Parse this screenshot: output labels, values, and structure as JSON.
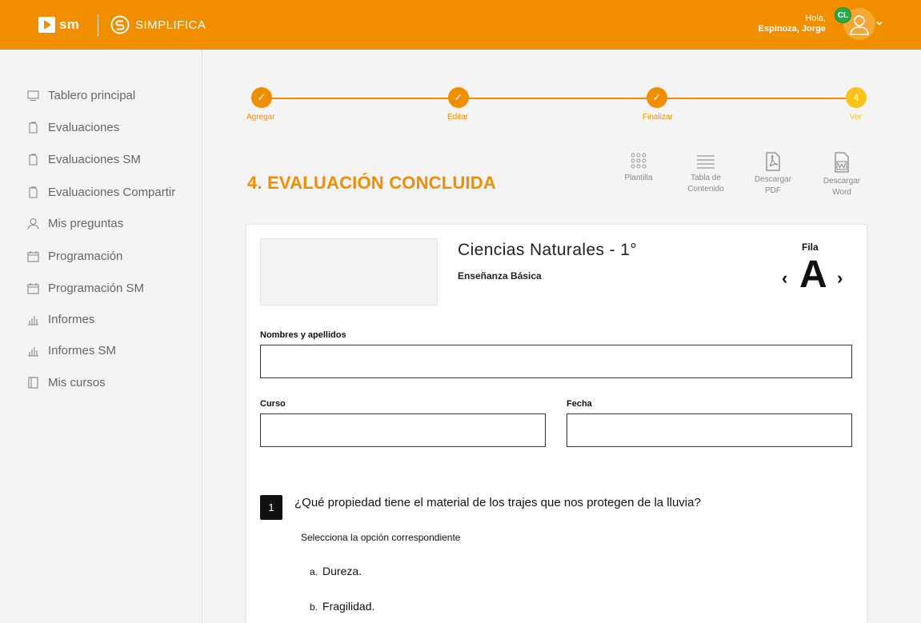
{
  "header": {
    "brand_sm": "sm",
    "brand_simplifica": "SIMPLIFICA",
    "greeting": "Hola,",
    "user_name": "Espinoza, Jorge",
    "badge": "CL",
    "accent_color": "#f18e00"
  },
  "sidebar": {
    "items": [
      {
        "label": "Tablero principal",
        "icon": "monitor-icon"
      },
      {
        "label": "Evaluaciones",
        "icon": "document-icon"
      },
      {
        "label": "Evaluaciones SM",
        "icon": "document-icon"
      },
      {
        "label": "Evaluaciones Compartir",
        "icon": "document-icon"
      },
      {
        "label": "Mis preguntas",
        "icon": "user-icon"
      },
      {
        "label": "Programación",
        "icon": "calendar-icon"
      },
      {
        "label": "Programación SM",
        "icon": "calendar-icon"
      },
      {
        "label": "Informes",
        "icon": "bar-chart-icon"
      },
      {
        "label": "Informes SM",
        "icon": "bar-chart-icon"
      },
      {
        "label": "Mis cursos",
        "icon": "book-icon"
      }
    ]
  },
  "stepper": {
    "steps": [
      {
        "label": "Agregar",
        "mark": "✓"
      },
      {
        "label": "Editar",
        "mark": "✓"
      },
      {
        "label": "Finalizar",
        "mark": "✓"
      },
      {
        "label": "Ver",
        "mark": "4"
      }
    ]
  },
  "page": {
    "title": "4. EVALUACIÓN CONCLUIDA"
  },
  "toolbar": {
    "plantilla": "Plantilla",
    "tabla_1": "Tabla de",
    "tabla_2": "Contenido",
    "pdf_1": "Descargar",
    "pdf_2": "PDF",
    "word_1": "Descargar",
    "word_2": "Word"
  },
  "evaluation": {
    "subject": "Ciencias Naturales - 1°",
    "level": "Enseñanza Básica",
    "fila_label": "Fila",
    "fila_value": "A",
    "prev_arrow": "‹",
    "next_arrow": "›",
    "fields": {
      "name_label": "Nombres y apellidos",
      "curso_label": "Curso",
      "fecha_label": "Fecha"
    },
    "question": {
      "number": "1",
      "text": "¿Qué propiedad tiene el material de los trajes que nos protegen de la lluvia?",
      "instruction": "Selecciona la opción correspondiente",
      "options": [
        {
          "letter": "a.",
          "text": "Dureza."
        },
        {
          "letter": "b.",
          "text": "Fragilidad."
        }
      ]
    }
  }
}
